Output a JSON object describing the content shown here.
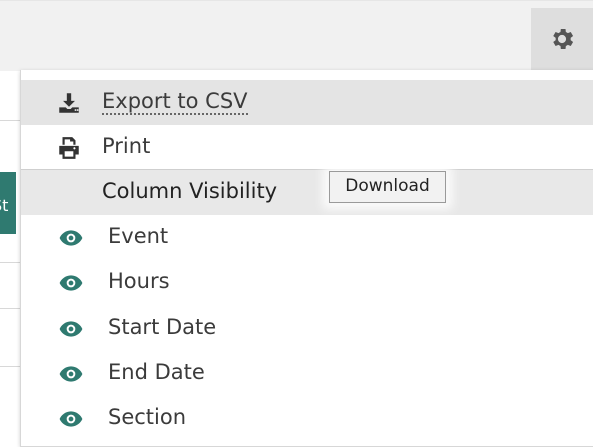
{
  "toolbar": {
    "gear_icon": "gear-icon"
  },
  "background_fragment": {
    "tab_char": "St"
  },
  "menu": {
    "export_label": "Export to CSV",
    "print_label": "Print",
    "column_visibility_label": "Column Visibility",
    "columns": [
      {
        "label": "Event",
        "visible": true
      },
      {
        "label": "Hours",
        "visible": true
      },
      {
        "label": "Start Date",
        "visible": true
      },
      {
        "label": "End Date",
        "visible": true
      },
      {
        "label": "Section",
        "visible": true
      }
    ]
  },
  "tooltip": {
    "text": "Download"
  },
  "colors": {
    "eye": "#2f7a70",
    "tab": "#2f7a70"
  }
}
